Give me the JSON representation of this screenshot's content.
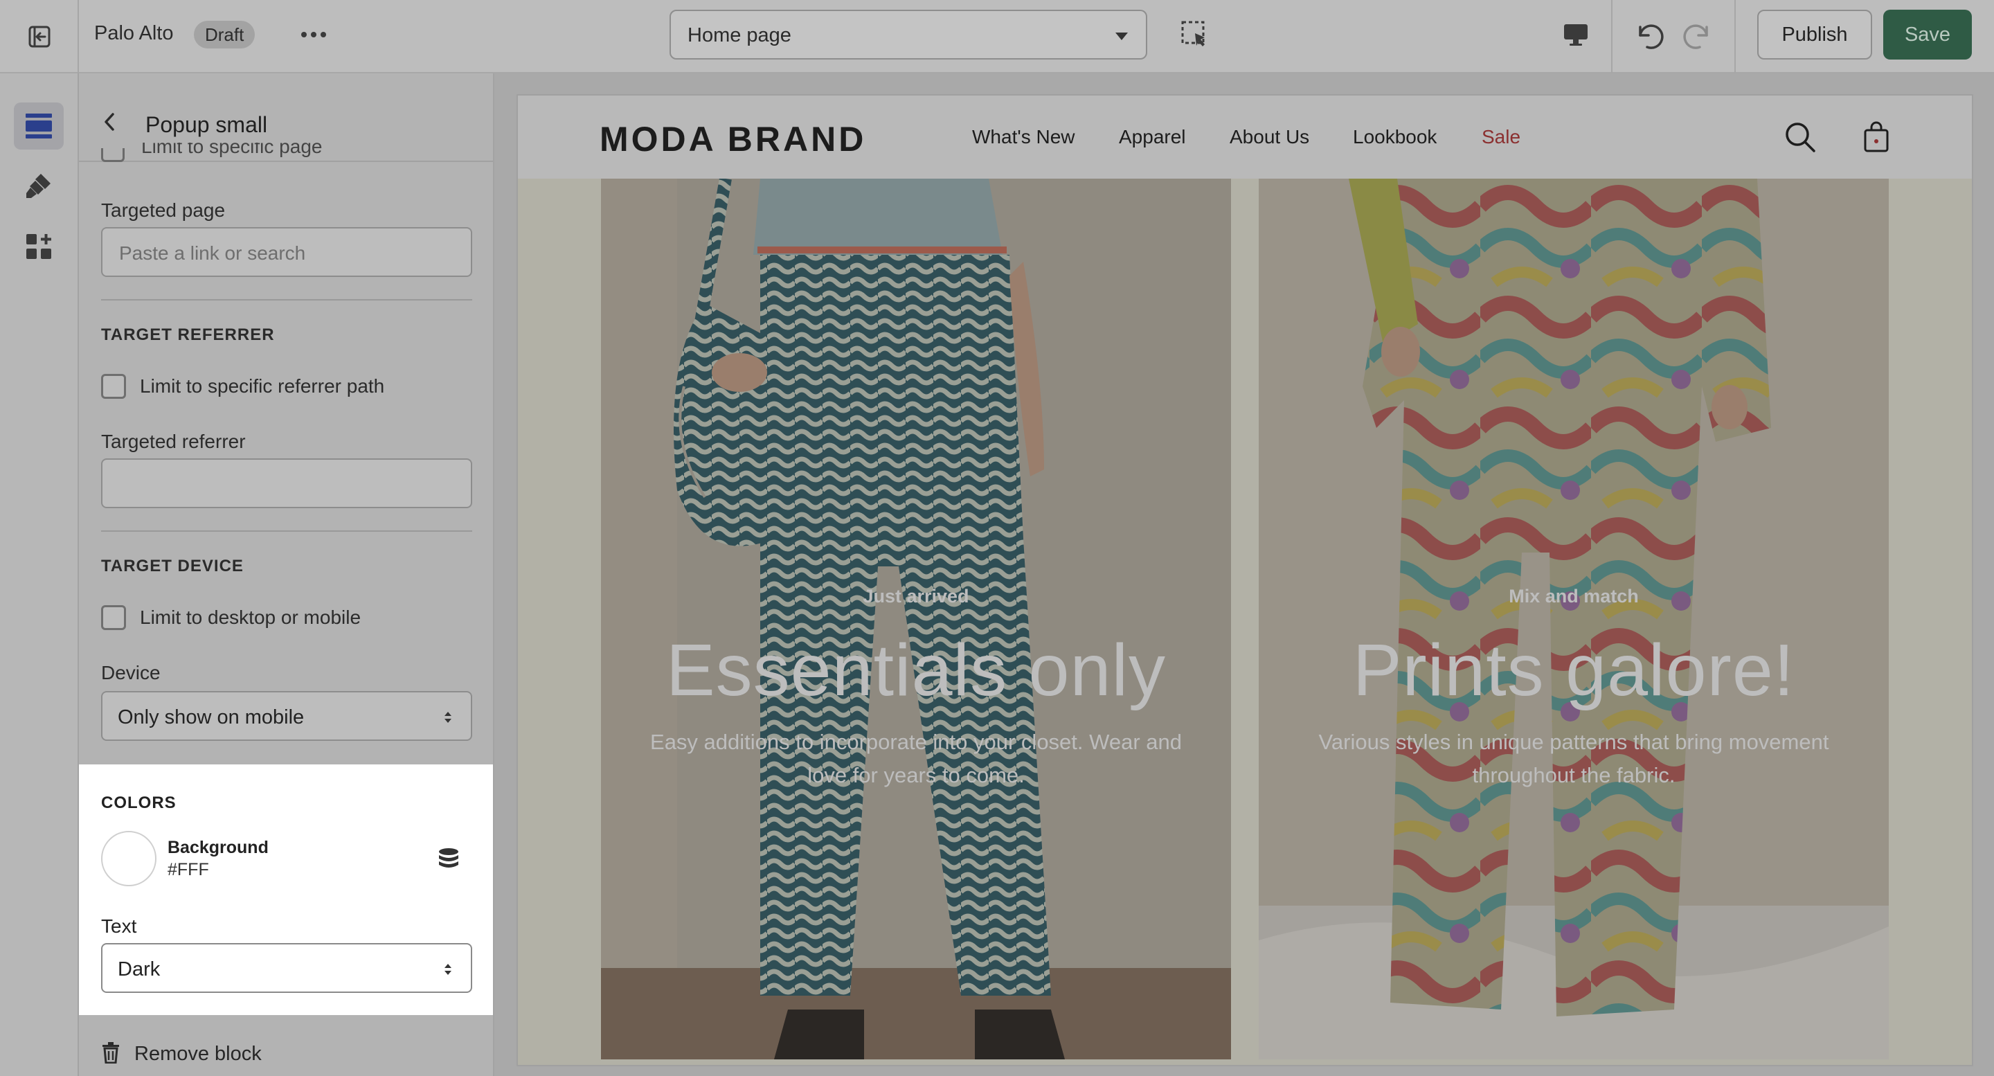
{
  "topbar": {
    "store_name": "Palo Alto",
    "status_badge": "Draft",
    "page_selector_value": "Home page",
    "publish_label": "Publish",
    "save_label": "Save"
  },
  "rail": {
    "items": [
      {
        "icon": "sections-icon",
        "active": true
      },
      {
        "icon": "theme-settings-icon",
        "active": false
      },
      {
        "icon": "app-embeds-icon",
        "active": false
      }
    ]
  },
  "panel": {
    "title": "Popup small",
    "hidden_checkbox_label": "Limit to specific page",
    "targeted_page": {
      "label": "Targeted page",
      "placeholder": "Paste a link or search"
    },
    "target_referrer": {
      "heading": "TARGET REFERRER",
      "checkbox_label": "Limit to specific referrer path",
      "field_label": "Targeted referrer",
      "value": ""
    },
    "target_device": {
      "heading": "TARGET DEVICE",
      "checkbox_label": "Limit to desktop or mobile",
      "field_label": "Device",
      "value": "Only show on mobile"
    },
    "colors": {
      "heading": "COLORS",
      "background_label": "Background",
      "background_value": "#FFF",
      "text_label": "Text",
      "text_value": "Dark"
    },
    "remove_label": "Remove block"
  },
  "preview": {
    "brand": "MODA BRAND",
    "nav": [
      "What's New",
      "Apparel",
      "About Us",
      "Lookbook",
      "Sale"
    ],
    "sale_color": "#8b3030",
    "heroes": [
      {
        "eyebrow": "Just arrived",
        "headline": "Essentials only",
        "body": "Easy additions to incorporate into your closet. Wear and love for years to come."
      },
      {
        "eyebrow": "Mix and match",
        "headline": "Prints galore!",
        "body": "Various styles in unique patterns that bring movement throughout the fabric."
      }
    ]
  },
  "colors": {
    "accent": "#2f5b45",
    "overlay": "#b3b3b3",
    "card": "#ffffff"
  }
}
